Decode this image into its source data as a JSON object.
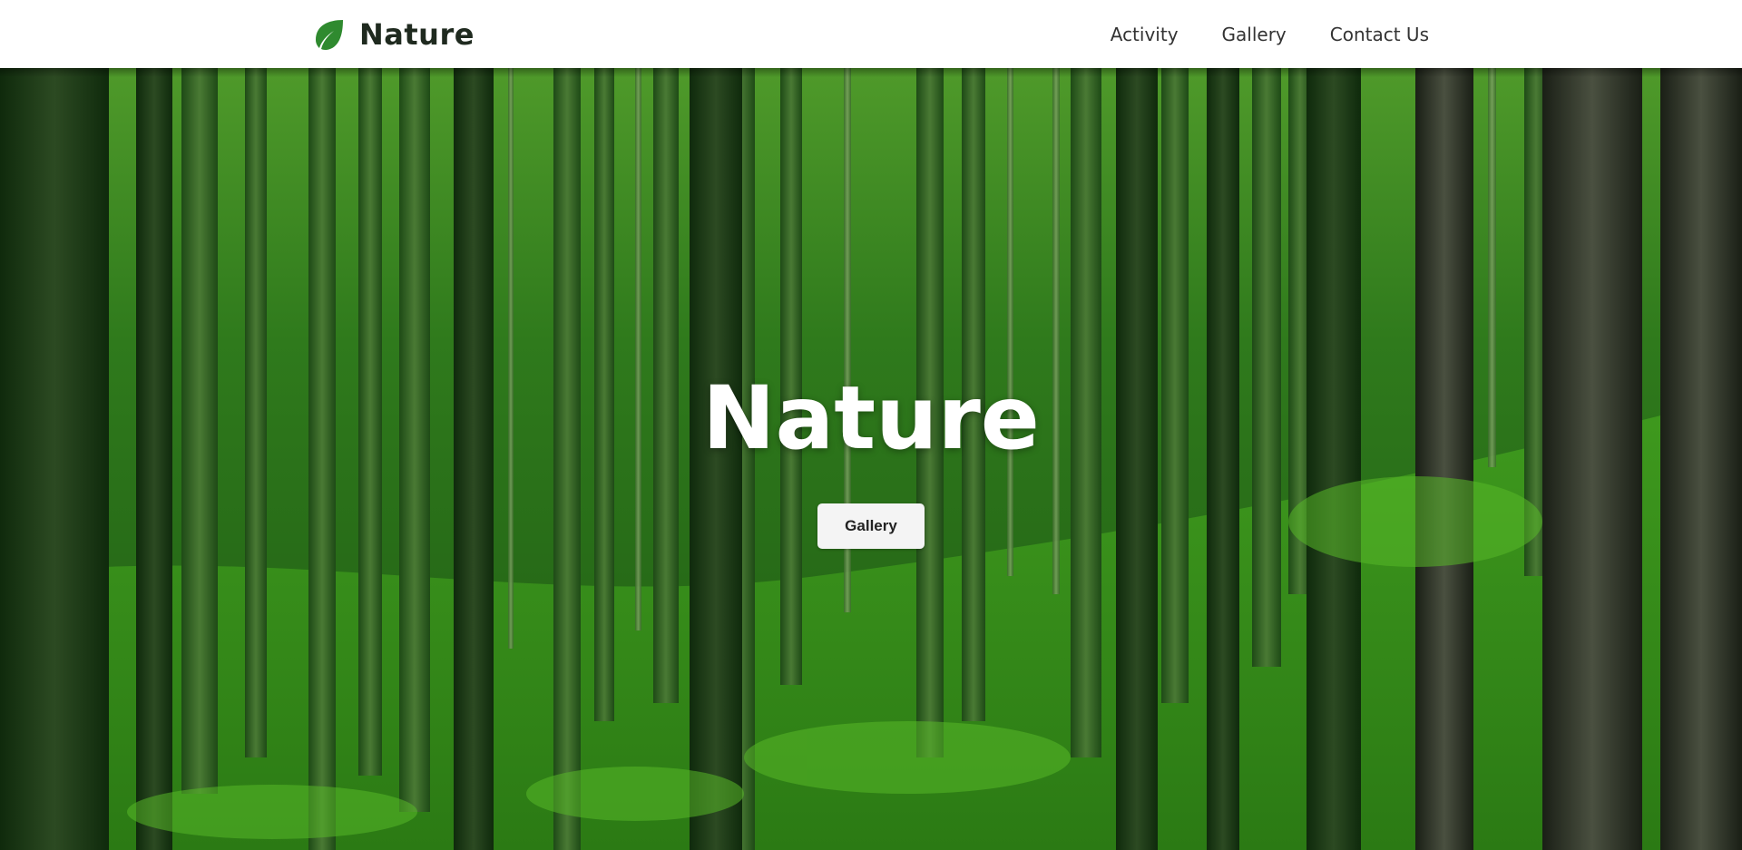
{
  "navbar": {
    "brand_icon": "leaf-icon",
    "brand_name": "Nature",
    "links": [
      {
        "label": "Activity"
      },
      {
        "label": "Gallery"
      },
      {
        "label": "Contact Us"
      }
    ]
  },
  "hero": {
    "title": "Nature",
    "button_label": "Gallery",
    "background": "forest-photo"
  },
  "colors": {
    "brand_green": "#2f8a2f",
    "nav_text": "#333333",
    "hero_text": "#ffffff",
    "button_bg": "#f4f4f4"
  }
}
